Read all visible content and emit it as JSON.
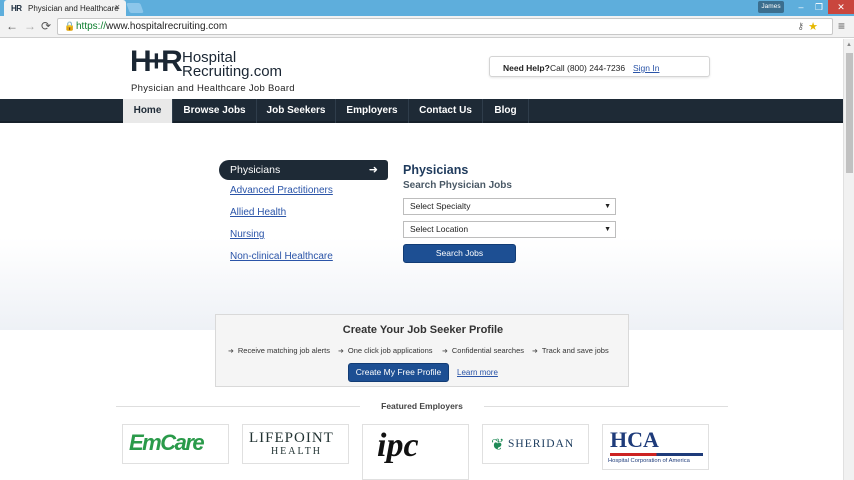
{
  "browser": {
    "tab_title": "Physician and Healthcare",
    "tab_favicon": "HR",
    "user_name": "James",
    "url_scheme": "https://",
    "url_host": "www.hospitalrecruiting.com",
    "icons": {
      "back": "back-arrow-icon",
      "forward": "forward-arrow-icon",
      "reload": "reload-icon",
      "lock": "lock-icon",
      "star": "bookmark-star-icon",
      "menu": "hamburger-menu-icon"
    }
  },
  "header": {
    "logo_mark": "H+R",
    "logo_line1": "Hospital",
    "logo_line2": "Recruiting.com",
    "tagline": "Physician and Healthcare Job Board",
    "help_label": "Need Help?",
    "help_phone": "Call (800) 244-7236",
    "signin_label": "Sign In"
  },
  "nav": {
    "items": [
      "Home",
      "Browse Jobs",
      "Job Seekers",
      "Employers",
      "Contact Us",
      "Blog"
    ],
    "active": "Home"
  },
  "categories": {
    "active": "Physicians",
    "links": [
      "Advanced Practitioners",
      "Allied Health",
      "Nursing",
      "Non-clinical Healthcare"
    ]
  },
  "search": {
    "title": "Physicians",
    "subtitle": "Search Physician Jobs",
    "specialty_selected": "Select Specialty",
    "location_selected": "Select Location",
    "button_label": "Search Jobs"
  },
  "profile": {
    "title": "Create Your Job Seeker Profile",
    "bullets": [
      "Receive matching job alerts",
      "One click job applications",
      "Confidential searches",
      "Track and save jobs"
    ],
    "create_label": "Create My Free Profile",
    "learn_more": "Learn more"
  },
  "featured": {
    "label": "Featured Employers",
    "employers": {
      "emcare": "EmCare",
      "lifepoint_1": "LIFEPOINT",
      "lifepoint_2": "HEALTH",
      "ipc": "ipc",
      "sheridan": "SHERIDAN",
      "hca": "HCA",
      "hca_sub": "Hospital Corporation of America"
    }
  },
  "colors": {
    "nav_bg": "#1e2a36",
    "link": "#2a54a8",
    "button": "#1d4f93",
    "browser_titlebar": "#5eaedc"
  }
}
